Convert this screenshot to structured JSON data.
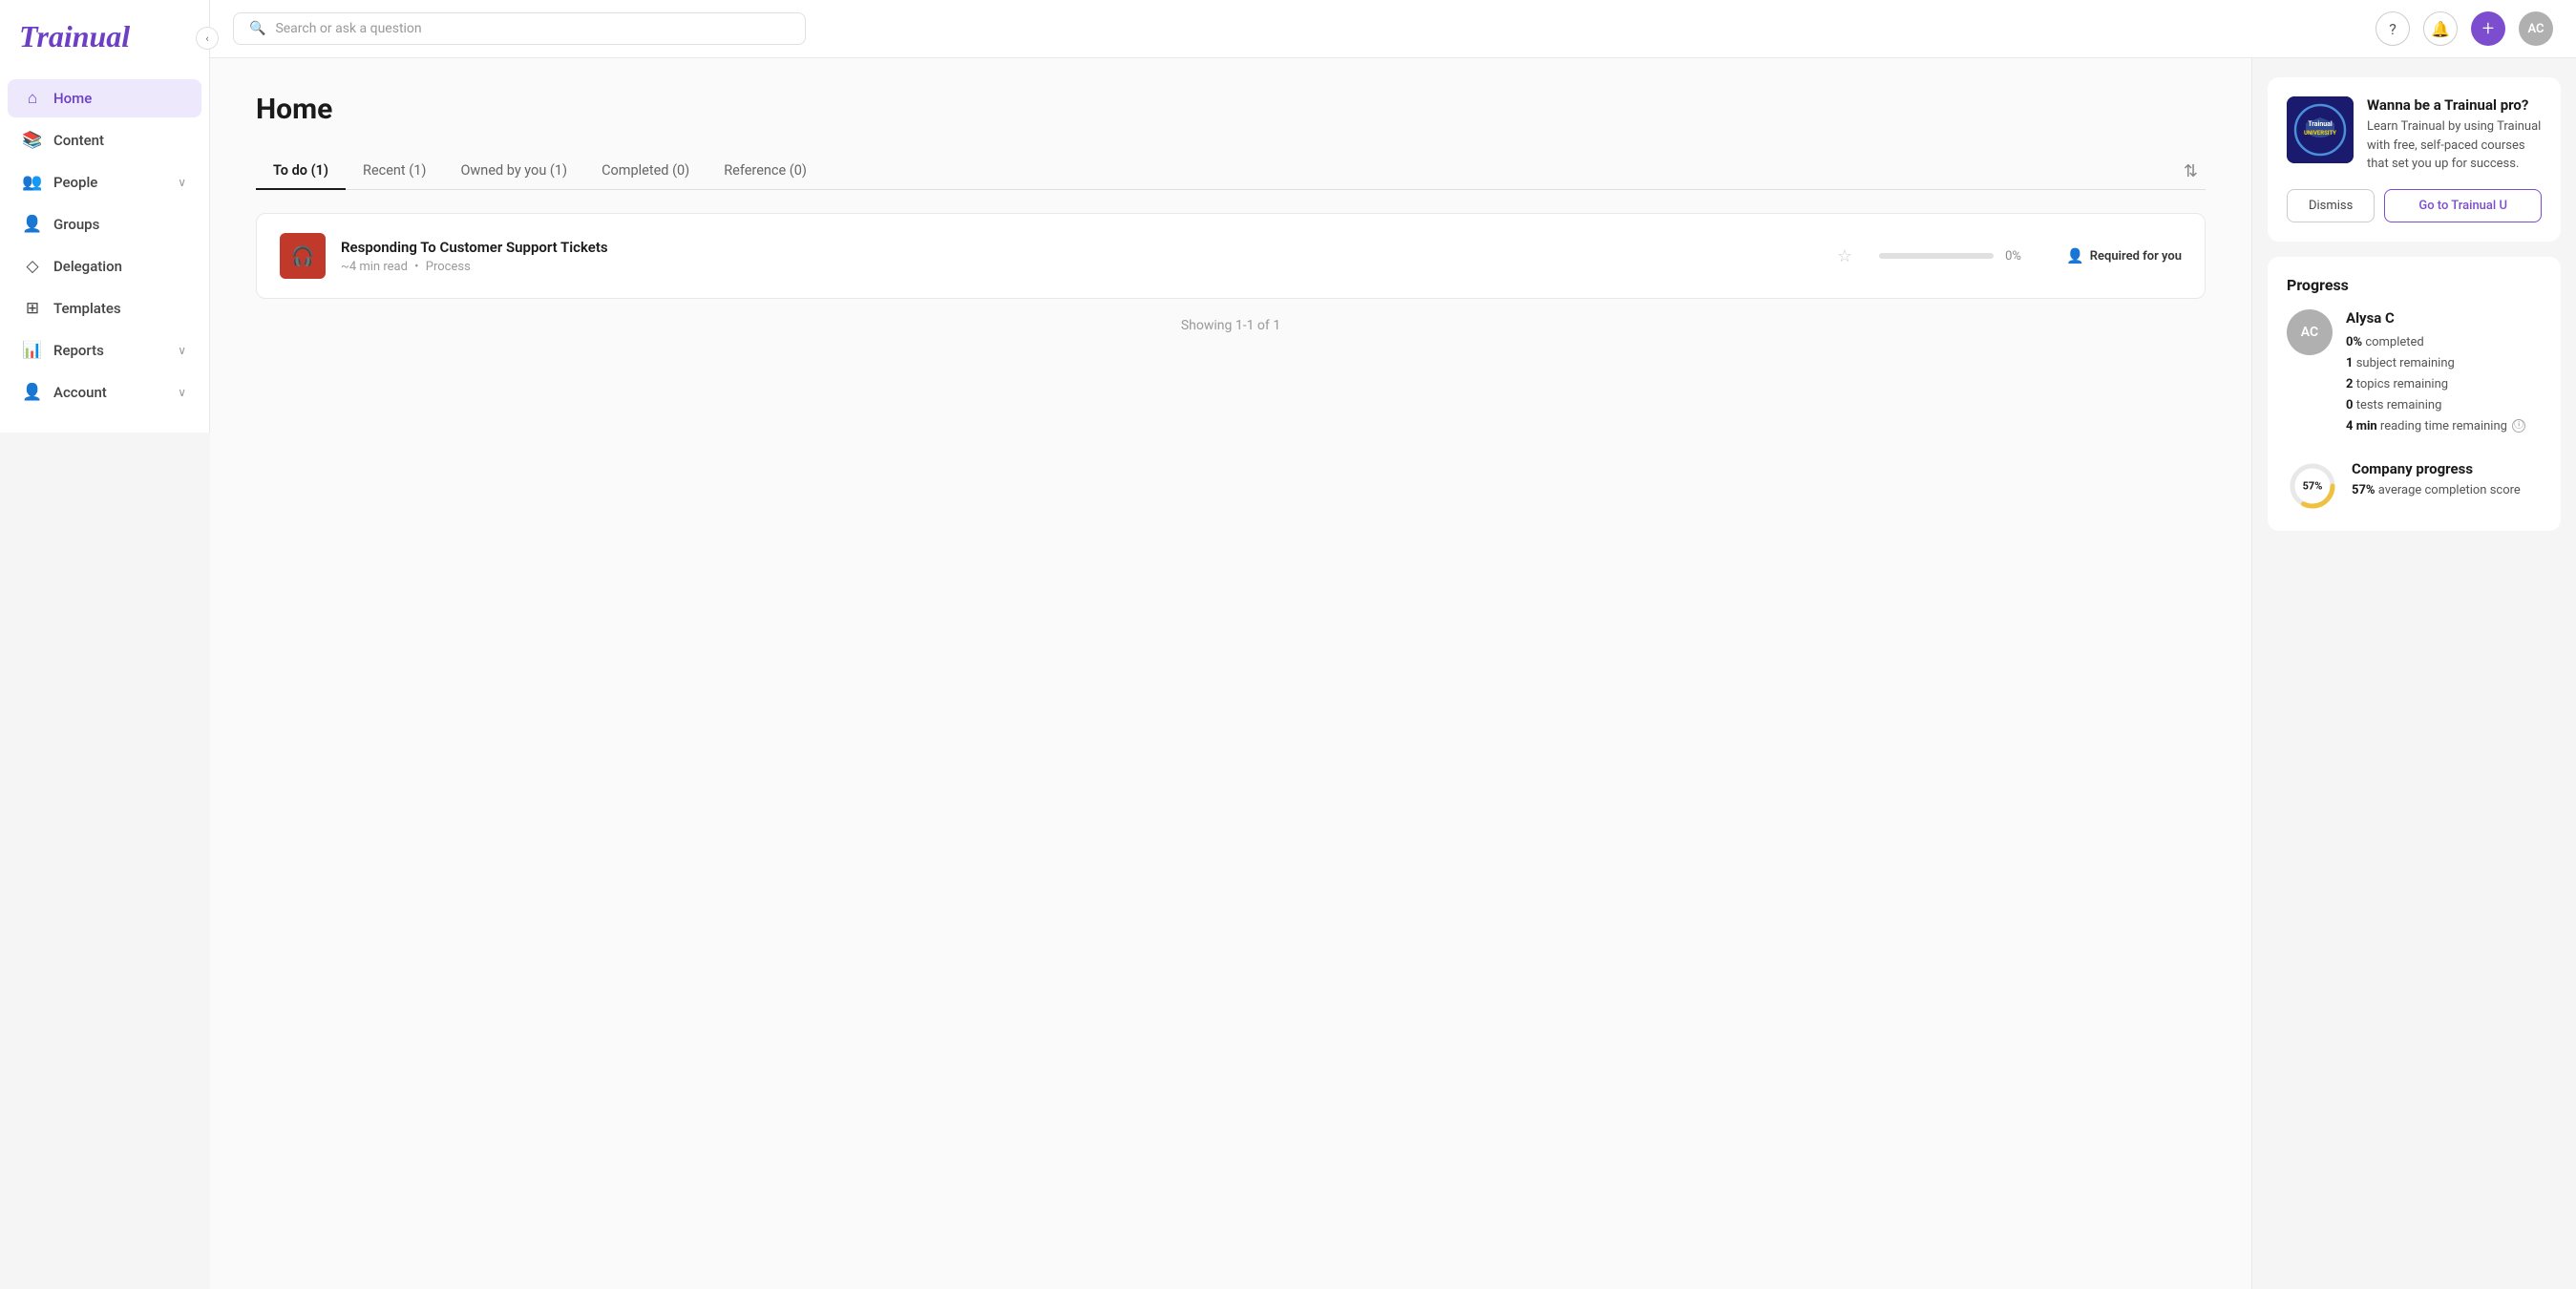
{
  "app": {
    "logo": "Trainual"
  },
  "header": {
    "search_placeholder": "Search or ask a question",
    "add_btn_label": "+",
    "avatar_label": "AC"
  },
  "sidebar": {
    "collapse_icon": "‹",
    "items": [
      {
        "id": "home",
        "label": "Home",
        "icon": "⌂",
        "active": true
      },
      {
        "id": "content",
        "label": "Content",
        "icon": "📚",
        "active": false
      },
      {
        "id": "people",
        "label": "People",
        "icon": "👥",
        "active": false,
        "has_chevron": true
      },
      {
        "id": "groups",
        "label": "Groups",
        "icon": "👤",
        "active": false
      },
      {
        "id": "delegation",
        "label": "Delegation",
        "icon": "◇",
        "active": false
      },
      {
        "id": "templates",
        "label": "Templates",
        "icon": "⊞",
        "active": false
      },
      {
        "id": "reports",
        "label": "Reports",
        "icon": "📊",
        "active": false,
        "has_chevron": true
      },
      {
        "id": "account",
        "label": "Account",
        "icon": "👤",
        "active": false,
        "has_chevron": true
      }
    ]
  },
  "main": {
    "title": "Home",
    "tabs": [
      {
        "id": "todo",
        "label": "To do (1)",
        "active": true
      },
      {
        "id": "recent",
        "label": "Recent (1)",
        "active": false
      },
      {
        "id": "owned",
        "label": "Owned by you (1)",
        "active": false
      },
      {
        "id": "completed",
        "label": "Completed (0)",
        "active": false
      },
      {
        "id": "reference",
        "label": "Reference (0)",
        "active": false
      }
    ],
    "task": {
      "title": "Responding To Customer Support Tickets",
      "meta_time": "~4 min read",
      "meta_separator": "•",
      "meta_type": "Process",
      "progress_pct": 0,
      "progress_label": "0%",
      "required_label": "Required for you"
    },
    "showing_text": "Showing 1-1 of 1"
  },
  "right_panel": {
    "trainual_u": {
      "title": "Wanna be a Trainual pro?",
      "description": "Learn Trainual by using Trainual with free, self-paced courses that set you up for success.",
      "badge_line1": "Trainual",
      "badge_line2": "UNIVERSITY",
      "dismiss_label": "Dismiss",
      "goto_label": "Go to Trainual U"
    },
    "progress": {
      "section_title": "Progress",
      "user": {
        "avatar": "AC",
        "name": "Alysa C",
        "completed_pct": "0%",
        "completed_label": "completed",
        "subjects_remaining": "1",
        "subjects_label": "subject remaining",
        "topics_remaining": "2",
        "topics_label": "topics remaining",
        "tests_remaining": "0",
        "tests_label": "tests remaining",
        "reading_time": "4 min",
        "reading_label": "reading time remaining"
      },
      "company": {
        "donut_pct": 57,
        "donut_label": "57%",
        "name": "Company progress",
        "avg_pct": "57%",
        "avg_label": "average completion score"
      }
    }
  }
}
